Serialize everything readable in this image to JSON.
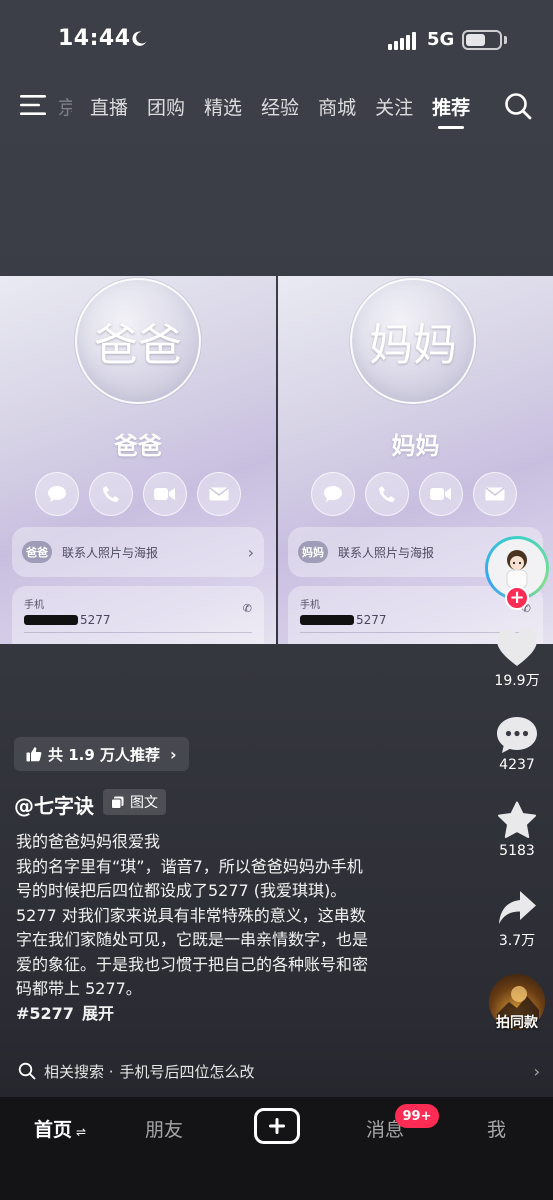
{
  "status_bar": {
    "time": "14:44",
    "network": "5G",
    "battery_level": 0.6
  },
  "nav": {
    "faded_tab": "京",
    "tabs": [
      "直播",
      "团购",
      "精选",
      "经验",
      "商城",
      "关注"
    ],
    "active_tab": "推荐"
  },
  "media": {
    "left": {
      "avatar_text": "爸爸",
      "name": "爸爸",
      "badge": "爸爸",
      "poster_label": "联系人照片与海报",
      "phone_label": "手机",
      "phone_suffix": "5277"
    },
    "right": {
      "avatar_text": "妈妈",
      "name": "妈妈",
      "badge": "妈妈",
      "poster_label": "联系人照片与海报",
      "phone_label": "手机",
      "phone_suffix": "5277"
    }
  },
  "rail": {
    "likes": "19.9万",
    "comments": "4237",
    "favorites": "5183",
    "shares": "3.7万",
    "same_style": "拍同款"
  },
  "info": {
    "recommend": "共 1.9 万人推荐",
    "author": "@七字诀",
    "type_tag": "图文",
    "caption_lines": [
      "我的爸爸妈妈很爱我",
      "我的名字里有“琪”，谐音7，所以爸爸妈妈办手机",
      "号的时候把后四位都设成了5277 (我爱琪琪)。",
      "5277 对我们家来说具有非常特殊的意义，这串数",
      "字在我们家随处可见，它既是一串亲情数字，也是",
      "爱的象征。于是我也习惯于把自己的各种账号和密",
      "码都带上 5277。"
    ],
    "hashtag": "#5277",
    "expand": "展开",
    "related_prefix": "相关搜索 ·",
    "related_query": "手机号后四位怎么改"
  },
  "bottom_nav": {
    "home": "首页",
    "friends": "朋友",
    "messages": "消息",
    "messages_badge": "99+",
    "me": "我"
  },
  "colors": {
    "accent": "#fe2c55",
    "bottom_bar": "#141416"
  }
}
